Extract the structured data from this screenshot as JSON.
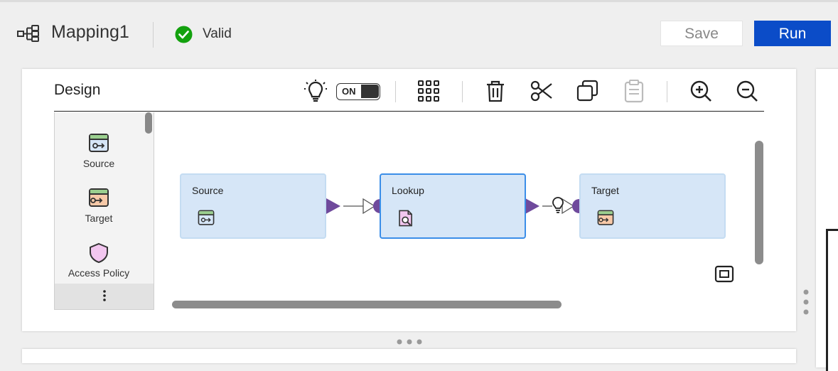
{
  "header": {
    "title": "Mapping1",
    "status": "Valid",
    "save_label": "Save",
    "run_label": "Run"
  },
  "design": {
    "title": "Design",
    "toggle_label": "ON",
    "toggle_state": "on"
  },
  "toolbar": {
    "icons": [
      "recommendation-lightbulb-icon",
      "grid-icon",
      "delete-icon",
      "cut-icon",
      "copy-icon",
      "paste-icon",
      "zoom-in-icon",
      "zoom-out-icon"
    ]
  },
  "palette": {
    "items": [
      {
        "label": "Source",
        "icon": "source-transform-icon"
      },
      {
        "label": "Target",
        "icon": "target-transform-icon"
      },
      {
        "label": "Access Policy",
        "icon": "shield-icon"
      }
    ],
    "more_label": "⋮"
  },
  "canvas": {
    "nodes": [
      {
        "label": "Source",
        "icon": "source-transform-icon"
      },
      {
        "label": "Lookup",
        "icon": "lookup-icon"
      },
      {
        "label": "Target",
        "icon": "target-transform-icon"
      }
    ]
  },
  "colors": {
    "accent": "#0b4cc8",
    "valid_green": "#13a10e",
    "node_bg": "#d6e6f7",
    "port_purple": "#6f4a9c"
  }
}
